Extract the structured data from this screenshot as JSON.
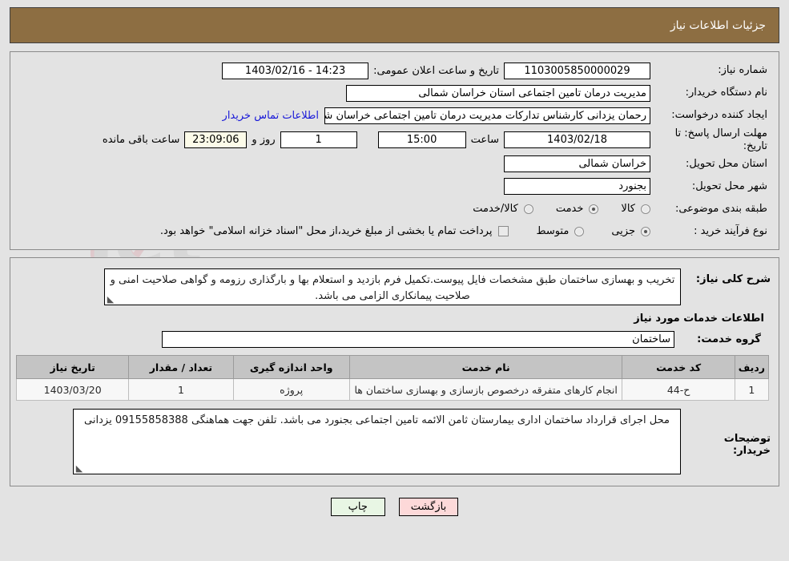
{
  "header": {
    "title": "جزئیات اطلاعات نیاز",
    "bg_color": "#8d6e42",
    "text_color": "#ffffff"
  },
  "fields": {
    "need_number_label": "شماره نیاز:",
    "need_number_value": "1103005850000029",
    "announce_label": "تاریخ و ساعت اعلان عمومی:",
    "announce_value": "14:23 - 1403/02/16",
    "buyer_org_label": "نام دستگاه خریدار:",
    "buyer_org_value": "مدیریت درمان تامین اجتماعی استان خراسان شمالی",
    "creator_label": "ایجاد کننده درخواست:",
    "creator_value": "رحمان یزدانی کارشناس تدارکات مدیریت درمان تامین اجتماعی خراسان شمالی",
    "contact_link": "اطلاعات تماس خریدار",
    "deadline_label": "مهلت ارسال پاسخ: تا تاریخ:",
    "deadline_date": "1403/02/18",
    "deadline_hour_label": "ساعت",
    "deadline_hour_value": "15:00",
    "days_value": "1",
    "days_unit": "روز و",
    "timer_value": "23:09:06",
    "timer_unit": "ساعت باقی مانده",
    "province_label": "استان محل تحویل:",
    "province_value": "خراسان شمالی",
    "city_label": "شهر محل تحویل:",
    "city_value": "بجنورد"
  },
  "classification": {
    "label": "طبقه بندی موضوعی:",
    "options": [
      {
        "label": "کالا",
        "selected": false
      },
      {
        "label": "خدمت",
        "selected": true
      },
      {
        "label": "کالا/خدمت",
        "selected": false
      }
    ]
  },
  "purchase_type": {
    "label": "نوع فرآیند خرید :",
    "options": [
      {
        "label": "جزیی",
        "selected": true
      },
      {
        "label": "متوسط",
        "selected": false
      }
    ],
    "checkbox_checked": false,
    "checkbox_note": "پرداخت تمام یا بخشی از مبلغ خرید،از محل \"اسناد خزانه اسلامی\" خواهد بود."
  },
  "description": {
    "label": "شرح کلی نیاز:",
    "value": "تخریب و بهسازی ساختمان طبق مشخصات فایل پیوست.تکمیل فرم بازدید و استعلام بها و بارگذاری رزومه و گواهی صلاحیت امنی و صلاحیت پیمانکاری الزامی می باشد."
  },
  "services_section": {
    "heading": "اطلاعات خدمات مورد نیاز",
    "group_label": "گروه خدمت:",
    "group_value": "ساختمان"
  },
  "table": {
    "columns": [
      "ردیف",
      "کد خدمت",
      "نام خدمت",
      "واحد اندازه گیری",
      "تعداد / مقدار",
      "تاریخ نیاز"
    ],
    "rows": [
      {
        "radif": "1",
        "code": "ح-44",
        "name": "انجام کارهای متفرقه درخصوص بازسازی و بهسازی ساختمان ها",
        "unit": "پروژه",
        "qty": "1",
        "date": "1403/03/20"
      }
    ]
  },
  "buyer_notes": {
    "label": "توضیحات خریدار:",
    "value": "محل اجرای قرارداد ساختمان اداری بیمارستان ثامن الائمه تامین اجتماعی بجنورد می باشد. تلفن جهت هماهنگی 09155858388 یزدانی"
  },
  "footer": {
    "back_label": "بازگشت",
    "print_label": "چاپ",
    "back_color": "#fdd9d9",
    "print_color": "#e8f6e4"
  },
  "watermark": {
    "text": "AriaTender.net"
  }
}
